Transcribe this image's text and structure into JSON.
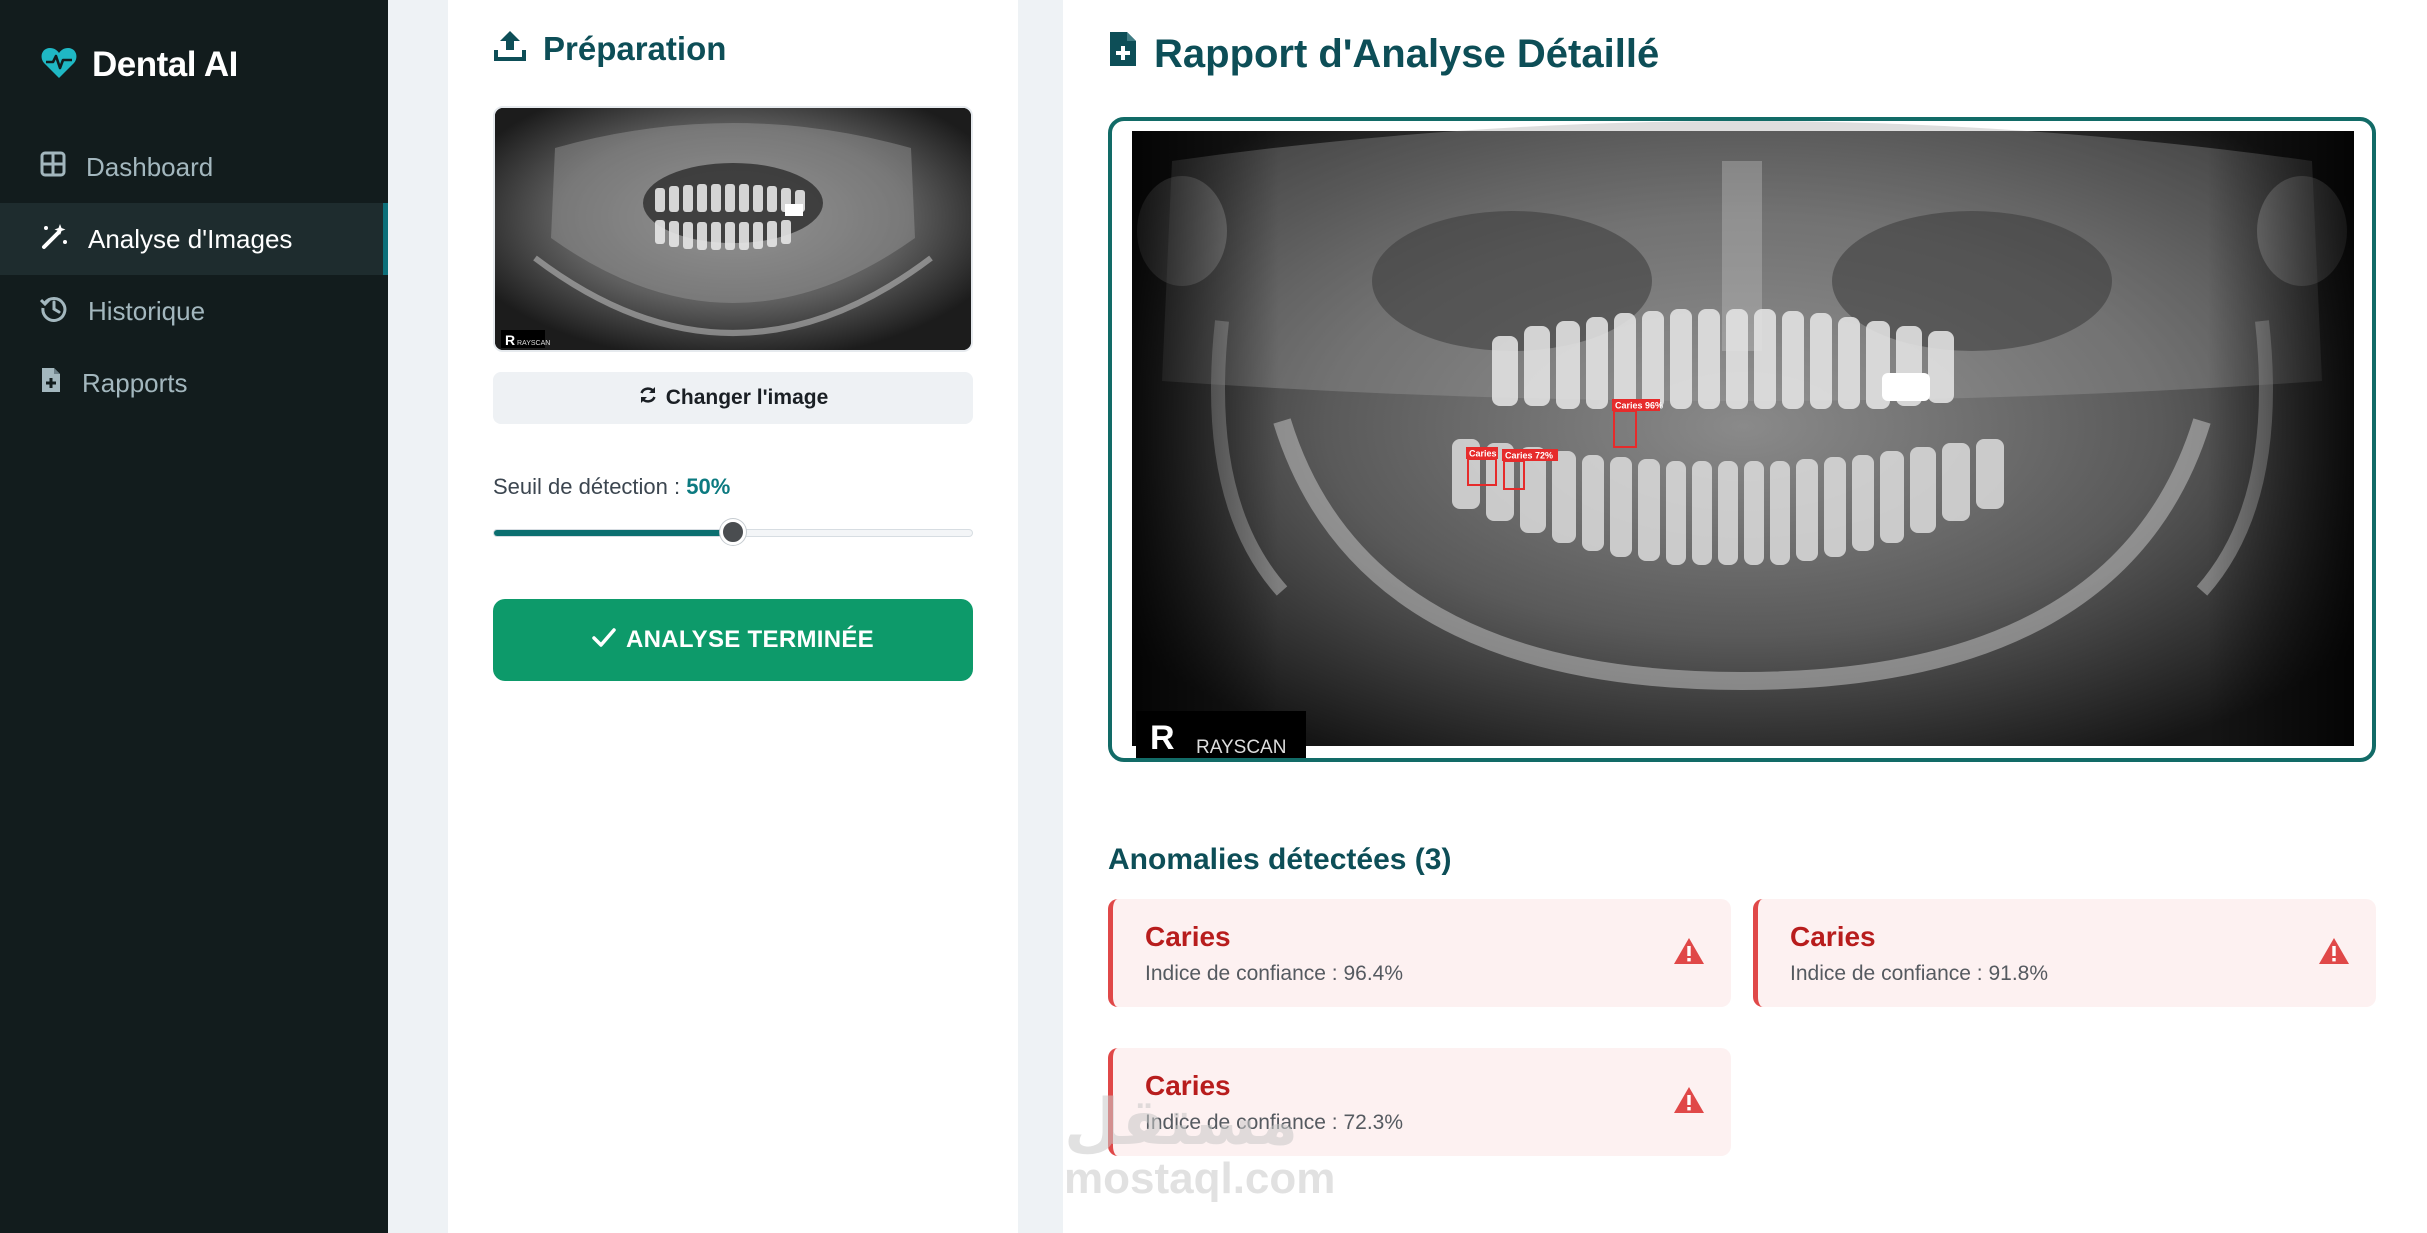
{
  "sidebar": {
    "brand": "Dental AI",
    "items": [
      {
        "label": "Dashboard",
        "icon": "grid-icon",
        "active": false
      },
      {
        "label": "Analyse d'Images",
        "icon": "magic-wand-icon",
        "active": true
      },
      {
        "label": "Historique",
        "icon": "history-icon",
        "active": false
      },
      {
        "label": "Rapports",
        "icon": "report-file-icon",
        "active": false
      }
    ]
  },
  "preparation": {
    "title": "Préparation",
    "thumb_logo_letter": "R",
    "thumb_logo_text": "RAYSCAN",
    "change_button": "Changer l'image",
    "threshold_label": "Seuil de détection :",
    "threshold_value": "50%",
    "threshold_fraction": 0.5,
    "done_button": "ANALYSE TERMINÉE"
  },
  "report": {
    "title": "Rapport d'Analyse Détaillé",
    "xray_logo_letter": "R",
    "xray_logo_text": "RAYSCAN",
    "detections": [
      {
        "label": "Caries 96%"
      },
      {
        "label": "Caries"
      },
      {
        "label": "Caries 72%"
      }
    ],
    "anomalies_title": "Anomalies détectées (3)",
    "anomalies": [
      {
        "name": "Caries",
        "confidence": "Indice de confiance : 96.4%"
      },
      {
        "name": "Caries",
        "confidence": "Indice de confiance : 91.8%"
      },
      {
        "name": "Caries",
        "confidence": "Indice de confiance : 72.3%"
      }
    ]
  },
  "watermark": {
    "arabic": "مستقل",
    "url": "mostaql.com"
  },
  "colors": {
    "sidebar_bg": "#121c1d",
    "accent_teal": "#0c6f79",
    "success": "#0d9a6a",
    "danger": "#e04848"
  }
}
